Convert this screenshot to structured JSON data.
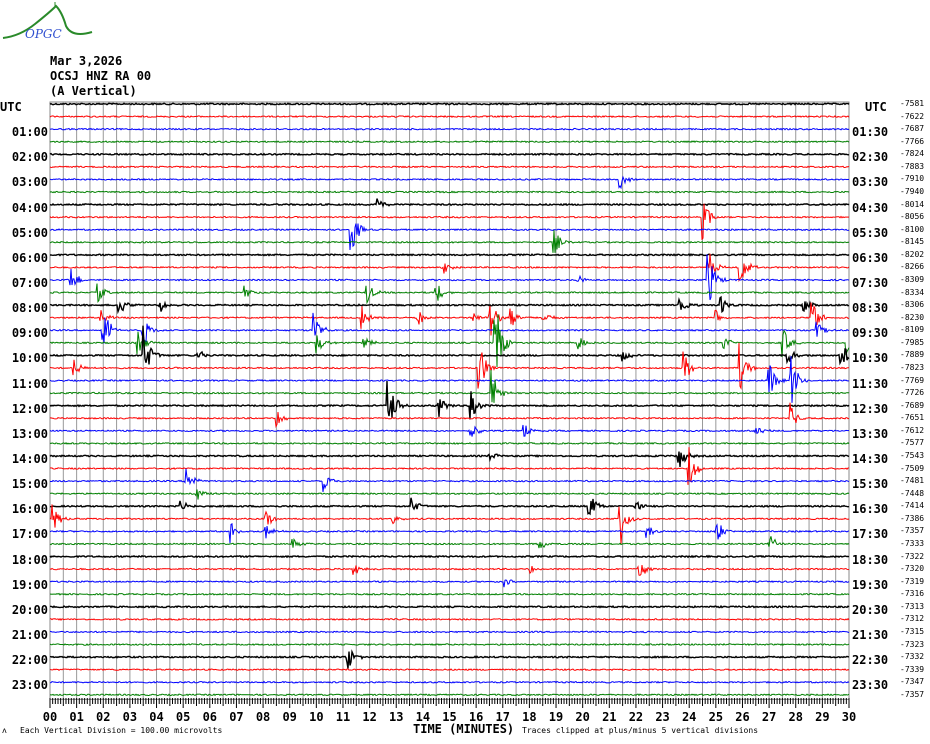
{
  "logo_text": "OPGC",
  "header": {
    "date": "Mar 3,2026",
    "station": "OCSJ HNZ RA 00",
    "component": "(A Vertical)"
  },
  "chart_data": {
    "type": "line",
    "title": "OCSJ HNZ RA 00 (A Vertical) Mar 3,2026",
    "xlabel": "TIME (MINUTES)",
    "xlim": [
      0,
      30
    ],
    "x_ticks": [
      "00",
      "01",
      "02",
      "03",
      "04",
      "05",
      "06",
      "07",
      "08",
      "09",
      "10",
      "11",
      "12",
      "13",
      "14",
      "15",
      "16",
      "17",
      "18",
      "19",
      "20",
      "21",
      "22",
      "23",
      "24",
      "25",
      "26",
      "27",
      "28",
      "29",
      "30"
    ],
    "left_axis_title": "UTC",
    "right_axis_title": "UTC",
    "left_labels": [
      "01:00",
      "02:00",
      "03:00",
      "04:00",
      "05:00",
      "06:00",
      "07:00",
      "08:00",
      "09:00",
      "10:00",
      "11:00",
      "12:00",
      "13:00",
      "14:00",
      "15:00",
      "16:00",
      "17:00",
      "18:00",
      "19:00",
      "20:00",
      "21:00",
      "22:00",
      "23:00"
    ],
    "right_labels": [
      "01:30",
      "02:30",
      "03:30",
      "04:30",
      "05:30",
      "06:30",
      "07:30",
      "08:30",
      "09:30",
      "10:30",
      "11:30",
      "12:30",
      "13:30",
      "14:30",
      "15:30",
      "16:30",
      "17:30",
      "18:30",
      "19:30",
      "20:30",
      "21:30",
      "22:30",
      "23:30"
    ],
    "trace_offsets": [
      "-7581",
      "-7622",
      "-7687",
      "-7766",
      "-7824",
      "-7883",
      "-7910",
      "-7940",
      "-8014",
      "-8056",
      "-8100",
      "-8145",
      "-8202",
      "-8266",
      "-8309",
      "-8334",
      "-8306",
      "-8230",
      "-8109",
      "-7985",
      "-7889",
      "-7823",
      "-7769",
      "-7726",
      "-7689",
      "-7651",
      "-7612",
      "-7577",
      "-7543",
      "-7509",
      "-7481",
      "-7448",
      "-7414",
      "-7386",
      "-7357",
      "-7333",
      "-7322",
      "-7320",
      "-7319",
      "-7316",
      "-7313",
      "-7312",
      "-7315",
      "-7323",
      "-7332",
      "-7339",
      "-7347",
      "-7357"
    ],
    "trace_colors": [
      "#000000",
      "#ff0000",
      "#0000ff",
      "#008000"
    ],
    "events": [
      {
        "trace": 6,
        "minute": 21.4,
        "amp": 0.8
      },
      {
        "trace": 8,
        "minute": 12.3,
        "amp": 0.6
      },
      {
        "trace": 9,
        "minute": 24.5,
        "amp": 1.8
      },
      {
        "trace": 10,
        "minute": 11.3,
        "amp": 2.2
      },
      {
        "trace": 11,
        "minute": 18.9,
        "amp": 1.2
      },
      {
        "trace": 13,
        "minute": 14.7,
        "amp": 0.8
      },
      {
        "trace": 13,
        "minute": 24.7,
        "amp": 1.6
      },
      {
        "trace": 13,
        "minute": 25.9,
        "amp": 1.8
      },
      {
        "trace": 14,
        "minute": 0.8,
        "amp": 1.2
      },
      {
        "trace": 14,
        "minute": 24.7,
        "amp": 2.5
      },
      {
        "trace": 14,
        "minute": 19.8,
        "amp": 0.6
      },
      {
        "trace": 15,
        "minute": 1.8,
        "amp": 0.8
      },
      {
        "trace": 15,
        "minute": 7.3,
        "amp": 0.8
      },
      {
        "trace": 15,
        "minute": 11.9,
        "amp": 1.0
      },
      {
        "trace": 15,
        "minute": 14.5,
        "amp": 1.0
      },
      {
        "trace": 16,
        "minute": 2.6,
        "amp": 0.8
      },
      {
        "trace": 16,
        "minute": 4.1,
        "amp": 0.7
      },
      {
        "trace": 16,
        "minute": 23.6,
        "amp": 1.2
      },
      {
        "trace": 16,
        "minute": 25.2,
        "amp": 0.8
      },
      {
        "trace": 16,
        "minute": 28.3,
        "amp": 0.7
      },
      {
        "trace": 17,
        "minute": 1.9,
        "amp": 0.8
      },
      {
        "trace": 17,
        "minute": 11.7,
        "amp": 1.0
      },
      {
        "trace": 17,
        "minute": 13.8,
        "amp": 0.8
      },
      {
        "trace": 17,
        "minute": 15.9,
        "amp": 0.7
      },
      {
        "trace": 17,
        "minute": 16.5,
        "amp": 2.0
      },
      {
        "trace": 17,
        "minute": 17.3,
        "amp": 1.0
      },
      {
        "trace": 17,
        "minute": 18.5,
        "amp": 0.7
      },
      {
        "trace": 17,
        "minute": 25.0,
        "amp": 0.8
      },
      {
        "trace": 17,
        "minute": 28.6,
        "amp": 2.0
      },
      {
        "trace": 18,
        "minute": 2.0,
        "amp": 2.0
      },
      {
        "trace": 18,
        "minute": 3.5,
        "amp": 1.5
      },
      {
        "trace": 18,
        "minute": 9.9,
        "amp": 1.8
      },
      {
        "trace": 18,
        "minute": 28.8,
        "amp": 0.8
      },
      {
        "trace": 19,
        "minute": 3.3,
        "amp": 1.5
      },
      {
        "trace": 19,
        "minute": 10.0,
        "amp": 1.0
      },
      {
        "trace": 19,
        "minute": 11.8,
        "amp": 0.7
      },
      {
        "trace": 19,
        "minute": 16.7,
        "amp": 4.5
      },
      {
        "trace": 19,
        "minute": 19.8,
        "amp": 0.8
      },
      {
        "trace": 19,
        "minute": 25.3,
        "amp": 0.7
      },
      {
        "trace": 19,
        "minute": 27.5,
        "amp": 1.5
      },
      {
        "trace": 19,
        "minute": 29.9,
        "amp": 1.5
      },
      {
        "trace": 20,
        "minute": 3.5,
        "amp": 2.5
      },
      {
        "trace": 20,
        "minute": 5.5,
        "amp": 0.7
      },
      {
        "trace": 20,
        "minute": 21.5,
        "amp": 0.6
      },
      {
        "trace": 20,
        "minute": 27.7,
        "amp": 0.8
      },
      {
        "trace": 20,
        "minute": 29.7,
        "amp": 1.5
      },
      {
        "trace": 21,
        "minute": 0.9,
        "amp": 0.8
      },
      {
        "trace": 21,
        "minute": 16.1,
        "amp": 2.5
      },
      {
        "trace": 21,
        "minute": 23.8,
        "amp": 1.5
      },
      {
        "trace": 21,
        "minute": 25.9,
        "amp": 2.0
      },
      {
        "trace": 22,
        "minute": 27.0,
        "amp": 1.5
      },
      {
        "trace": 22,
        "minute": 27.8,
        "amp": 2.5
      },
      {
        "trace": 23,
        "minute": 16.6,
        "amp": 2.0
      },
      {
        "trace": 24,
        "minute": 12.7,
        "amp": 2.5
      },
      {
        "trace": 24,
        "minute": 14.6,
        "amp": 1.0
      },
      {
        "trace": 24,
        "minute": 15.8,
        "amp": 1.2
      },
      {
        "trace": 25,
        "minute": 8.5,
        "amp": 0.8
      },
      {
        "trace": 25,
        "minute": 27.8,
        "amp": 1.2
      },
      {
        "trace": 26,
        "minute": 15.8,
        "amp": 0.8
      },
      {
        "trace": 26,
        "minute": 17.8,
        "amp": 0.6
      },
      {
        "trace": 26,
        "minute": 26.5,
        "amp": 0.6
      },
      {
        "trace": 28,
        "minute": 16.5,
        "amp": 0.6
      },
      {
        "trace": 28,
        "minute": 23.6,
        "amp": 1.2
      },
      {
        "trace": 29,
        "minute": 24.0,
        "amp": 1.8
      },
      {
        "trace": 30,
        "minute": 5.1,
        "amp": 1.5
      },
      {
        "trace": 30,
        "minute": 10.3,
        "amp": 1.0
      },
      {
        "trace": 31,
        "minute": 5.5,
        "amp": 0.8
      },
      {
        "trace": 32,
        "minute": 4.9,
        "amp": 0.5
      },
      {
        "trace": 32,
        "minute": 13.6,
        "amp": 0.7
      },
      {
        "trace": 32,
        "minute": 20.2,
        "amp": 1.5
      },
      {
        "trace": 32,
        "minute": 22.0,
        "amp": 0.5
      },
      {
        "trace": 33,
        "minute": 0.1,
        "amp": 1.2
      },
      {
        "trace": 33,
        "minute": 8.1,
        "amp": 0.8
      },
      {
        "trace": 33,
        "minute": 21.4,
        "amp": 2.5
      },
      {
        "trace": 33,
        "minute": 12.8,
        "amp": 0.5
      },
      {
        "trace": 34,
        "minute": 6.8,
        "amp": 1.0
      },
      {
        "trace": 34,
        "minute": 8.1,
        "amp": 0.6
      },
      {
        "trace": 34,
        "minute": 22.4,
        "amp": 0.7
      },
      {
        "trace": 34,
        "minute": 25.0,
        "amp": 1.2
      },
      {
        "trace": 35,
        "minute": 9.1,
        "amp": 0.6
      },
      {
        "trace": 35,
        "minute": 18.4,
        "amp": 0.5
      },
      {
        "trace": 35,
        "minute": 27.0,
        "amp": 1.0
      },
      {
        "trace": 37,
        "minute": 11.4,
        "amp": 0.7
      },
      {
        "trace": 37,
        "minute": 18.0,
        "amp": 0.4
      },
      {
        "trace": 37,
        "minute": 22.1,
        "amp": 1.2
      },
      {
        "trace": 38,
        "minute": 17.0,
        "amp": 0.6
      },
      {
        "trace": 44,
        "minute": 11.2,
        "amp": 1.0
      }
    ]
  },
  "footer": {
    "scale": "Each Vertical Division =  100.00 microvolts",
    "clip": "Traces clipped at plus/minus 5 vertical divisions"
  }
}
